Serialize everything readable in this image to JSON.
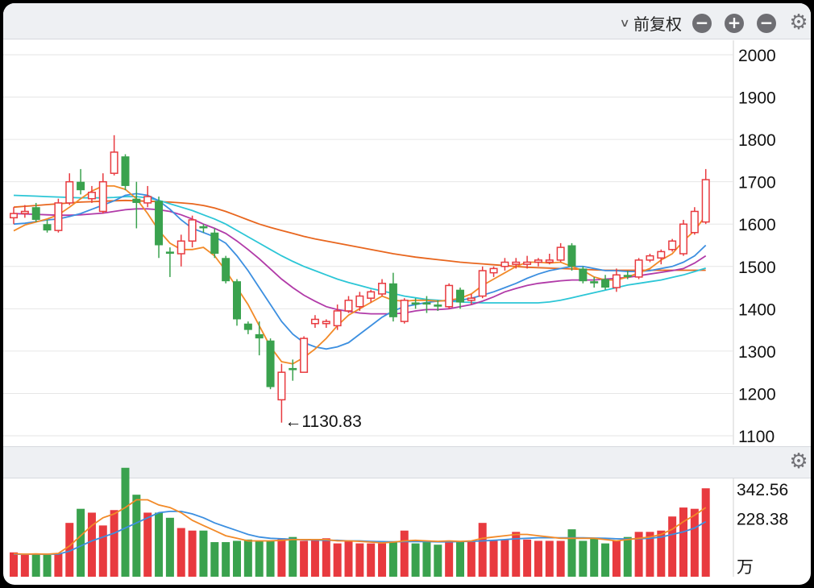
{
  "toolbar": {
    "adjust_label": "前复权",
    "icons": [
      "chevron-down-icon",
      "minus-circle-icon",
      "plus-circle-icon",
      "minus-circle-icon",
      "gear-icon"
    ]
  },
  "colors": {
    "up": "#e83a3f",
    "down": "#3aa24e",
    "ma5": "#f28a28",
    "ma10": "#3c8fe0",
    "ma20": "#b13aa8",
    "ma30": "#2cc6d6",
    "ma60": "#e8661e",
    "grid": "#e6e6e6"
  },
  "chart_data": [
    {
      "type": "candlestick",
      "ylim": [
        1080,
        2030
      ],
      "y_ticks": [
        2000,
        1900,
        1800,
        1700,
        1600,
        1500,
        1400,
        1300,
        1200,
        1100
      ],
      "annotation": "←1130.83",
      "annotation_value": 1130.83,
      "ohlc": [
        [
          1615,
          1640,
          1600,
          1625
        ],
        [
          1625,
          1645,
          1615,
          1630
        ],
        [
          1640,
          1650,
          1605,
          1610
        ],
        [
          1600,
          1610,
          1580,
          1585
        ],
        [
          1585,
          1660,
          1580,
          1650
        ],
        [
          1650,
          1720,
          1645,
          1700
        ],
        [
          1700,
          1730,
          1670,
          1680
        ],
        [
          1660,
          1690,
          1650,
          1675
        ],
        [
          1630,
          1720,
          1625,
          1700
        ],
        [
          1720,
          1810,
          1715,
          1770
        ],
        [
          1760,
          1765,
          1680,
          1690
        ],
        [
          1660,
          1700,
          1590,
          1650
        ],
        [
          1650,
          1690,
          1640,
          1665
        ],
        [
          1655,
          1665,
          1520,
          1550
        ],
        [
          1535,
          1545,
          1475,
          1530
        ],
        [
          1530,
          1575,
          1500,
          1560
        ],
        [
          1560,
          1620,
          1545,
          1610
        ],
        [
          1595,
          1600,
          1580,
          1590
        ],
        [
          1580,
          1590,
          1520,
          1530
        ],
        [
          1520,
          1525,
          1460,
          1465
        ],
        [
          1465,
          1470,
          1360,
          1375
        ],
        [
          1365,
          1370,
          1340,
          1350
        ],
        [
          1340,
          1370,
          1290,
          1330
        ],
        [
          1325,
          1330,
          1210,
          1215
        ],
        [
          1185,
          1270,
          1131,
          1250
        ],
        [
          1260,
          1280,
          1230,
          1255
        ],
        [
          1250,
          1335,
          1250,
          1330
        ],
        [
          1365,
          1385,
          1355,
          1375
        ],
        [
          1365,
          1375,
          1355,
          1370
        ],
        [
          1360,
          1410,
          1350,
          1395
        ],
        [
          1395,
          1430,
          1390,
          1420
        ],
        [
          1405,
          1440,
          1395,
          1430
        ],
        [
          1425,
          1445,
          1415,
          1440
        ],
        [
          1435,
          1470,
          1430,
          1460
        ],
        [
          1460,
          1485,
          1370,
          1380
        ],
        [
          1370,
          1425,
          1365,
          1420
        ],
        [
          1415,
          1425,
          1400,
          1410
        ],
        [
          1415,
          1430,
          1390,
          1410
        ],
        [
          1410,
          1420,
          1395,
          1405
        ],
        [
          1405,
          1460,
          1400,
          1455
        ],
        [
          1445,
          1450,
          1400,
          1415
        ],
        [
          1420,
          1435,
          1410,
          1425
        ],
        [
          1430,
          1500,
          1425,
          1490
        ],
        [
          1485,
          1500,
          1475,
          1495
        ],
        [
          1500,
          1520,
          1490,
          1510
        ],
        [
          1505,
          1520,
          1495,
          1510
        ],
        [
          1505,
          1525,
          1495,
          1510
        ],
        [
          1510,
          1520,
          1500,
          1515
        ],
        [
          1510,
          1530,
          1505,
          1515
        ],
        [
          1515,
          1555,
          1510,
          1545
        ],
        [
          1550,
          1555,
          1490,
          1500
        ],
        [
          1495,
          1500,
          1460,
          1465
        ],
        [
          1465,
          1475,
          1450,
          1460
        ],
        [
          1470,
          1480,
          1445,
          1450
        ],
        [
          1450,
          1495,
          1440,
          1480
        ],
        [
          1480,
          1490,
          1470,
          1475
        ],
        [
          1475,
          1520,
          1470,
          1515
        ],
        [
          1515,
          1530,
          1510,
          1525
        ],
        [
          1520,
          1540,
          1505,
          1535
        ],
        [
          1540,
          1565,
          1535,
          1560
        ],
        [
          1530,
          1610,
          1525,
          1600
        ],
        [
          1580,
          1640,
          1575,
          1630
        ],
        [
          1605,
          1730,
          1600,
          1705
        ]
      ],
      "ma5": [
        1584,
        1598,
        1605,
        1612,
        1622,
        1640,
        1660,
        1678,
        1690,
        1690,
        1682,
        1660,
        1625,
        1585,
        1555,
        1540,
        1540,
        1545,
        1525,
        1490,
        1450,
        1410,
        1360,
        1310,
        1275,
        1270,
        1285,
        1305,
        1330,
        1360,
        1385,
        1400,
        1415,
        1430,
        1420,
        1418,
        1420,
        1420,
        1418,
        1420,
        1425,
        1435,
        1455,
        1470,
        1485,
        1500,
        1510,
        1510,
        1508,
        1510,
        1500,
        1490,
        1475,
        1468,
        1468,
        1475,
        1485,
        1495,
        1515,
        1530,
        1560,
        1585,
        1620
      ],
      "ma10": [
        1600,
        1602,
        1606,
        1610,
        1612,
        1618,
        1625,
        1635,
        1645,
        1655,
        1668,
        1672,
        1668,
        1655,
        1635,
        1610,
        1590,
        1580,
        1570,
        1555,
        1525,
        1490,
        1450,
        1410,
        1370,
        1340,
        1320,
        1310,
        1305,
        1310,
        1320,
        1340,
        1360,
        1380,
        1395,
        1405,
        1410,
        1415,
        1418,
        1420,
        1420,
        1425,
        1432,
        1440,
        1450,
        1460,
        1472,
        1482,
        1490,
        1495,
        1500,
        1500,
        1495,
        1490,
        1490,
        1488,
        1488,
        1490,
        1495,
        1500,
        1510,
        1525,
        1550
      ],
      "ma20": [
        1625,
        1624,
        1623,
        1622,
        1621,
        1621,
        1622,
        1624,
        1626,
        1630,
        1634,
        1636,
        1636,
        1634,
        1630,
        1622,
        1612,
        1600,
        1590,
        1578,
        1560,
        1540,
        1518,
        1494,
        1470,
        1450,
        1432,
        1418,
        1405,
        1398,
        1394,
        1390,
        1388,
        1388,
        1388,
        1390,
        1395,
        1398,
        1398,
        1400,
        1405,
        1410,
        1418,
        1428,
        1440,
        1448,
        1455,
        1460,
        1463,
        1466,
        1468,
        1468,
        1468,
        1470,
        1472,
        1474,
        1478,
        1482,
        1486,
        1490,
        1495,
        1508,
        1525
      ],
      "ma30": [
        1668,
        1667,
        1666,
        1665,
        1664,
        1663,
        1662,
        1662,
        1662,
        1663,
        1665,
        1665,
        1662,
        1656,
        1648,
        1640,
        1632,
        1622,
        1612,
        1600,
        1585,
        1570,
        1555,
        1540,
        1525,
        1512,
        1500,
        1490,
        1480,
        1470,
        1462,
        1455,
        1448,
        1442,
        1436,
        1430,
        1426,
        1422,
        1420,
        1418,
        1416,
        1415,
        1414,
        1414,
        1414,
        1414,
        1414,
        1414,
        1416,
        1420,
        1426,
        1432,
        1438,
        1444,
        1450,
        1456,
        1460,
        1464,
        1468,
        1474,
        1480,
        1488,
        1496
      ],
      "ma60": [
        1640,
        1642,
        1644,
        1646,
        1648,
        1650,
        1652,
        1653,
        1654,
        1655,
        1656,
        1655,
        1654,
        1653,
        1652,
        1650,
        1648,
        1644,
        1638,
        1630,
        1620,
        1610,
        1600,
        1592,
        1585,
        1578,
        1571,
        1565,
        1560,
        1555,
        1550,
        1545,
        1540,
        1535,
        1530,
        1526,
        1522,
        1519,
        1516,
        1513,
        1510,
        1508,
        1506,
        1504,
        1502,
        1500,
        1498,
        1497,
        1496,
        1495,
        1494,
        1493,
        1492,
        1491,
        1491,
        1491,
        1491,
        1491,
        1491,
        1491,
        1491,
        1491,
        1491
      ]
    },
    {
      "type": "bar",
      "ylim": [
        0,
        430
      ],
      "y_ticks": [
        342.56,
        228.38
      ],
      "unit": "万",
      "volume": [
        95,
        85,
        90,
        85,
        90,
        210,
        265,
        250,
        200,
        260,
        425,
        320,
        250,
        250,
        230,
        190,
        180,
        180,
        135,
        135,
        140,
        145,
        140,
        140,
        150,
        155,
        140,
        145,
        150,
        130,
        140,
        130,
        130,
        130,
        135,
        180,
        130,
        135,
        125,
        135,
        140,
        140,
        210,
        140,
        145,
        175,
        145,
        140,
        140,
        140,
        185,
        140,
        150,
        130,
        140,
        155,
        175,
        175,
        180,
        235,
        270,
        265,
        345
      ],
      "ma_vol_5": [
        90,
        88,
        89,
        88,
        91,
        120,
        160,
        200,
        230,
        245,
        270,
        300,
        300,
        280,
        270,
        250,
        220,
        200,
        180,
        160,
        150,
        140,
        140,
        140,
        142,
        145,
        145,
        145,
        145,
        140,
        140,
        138,
        135,
        132,
        135,
        140,
        142,
        140,
        138,
        140,
        138,
        140,
        150,
        155,
        160,
        165,
        165,
        160,
        155,
        150,
        150,
        150,
        150,
        145,
        140,
        145,
        150,
        155,
        165,
        185,
        215,
        240,
        270
      ],
      "ma_vol_10": [
        88,
        88,
        88,
        88,
        88,
        100,
        120,
        140,
        155,
        170,
        190,
        210,
        230,
        250,
        255,
        255,
        245,
        230,
        210,
        195,
        180,
        165,
        155,
        150,
        148,
        146,
        144,
        143,
        142,
        142,
        140,
        140,
        138,
        137,
        136,
        137,
        137,
        137,
        136,
        136,
        137,
        138,
        140,
        142,
        145,
        148,
        150,
        152,
        152,
        152,
        152,
        152,
        151,
        150,
        148,
        147,
        148,
        150,
        155,
        165,
        175,
        190,
        215
      ]
    }
  ]
}
